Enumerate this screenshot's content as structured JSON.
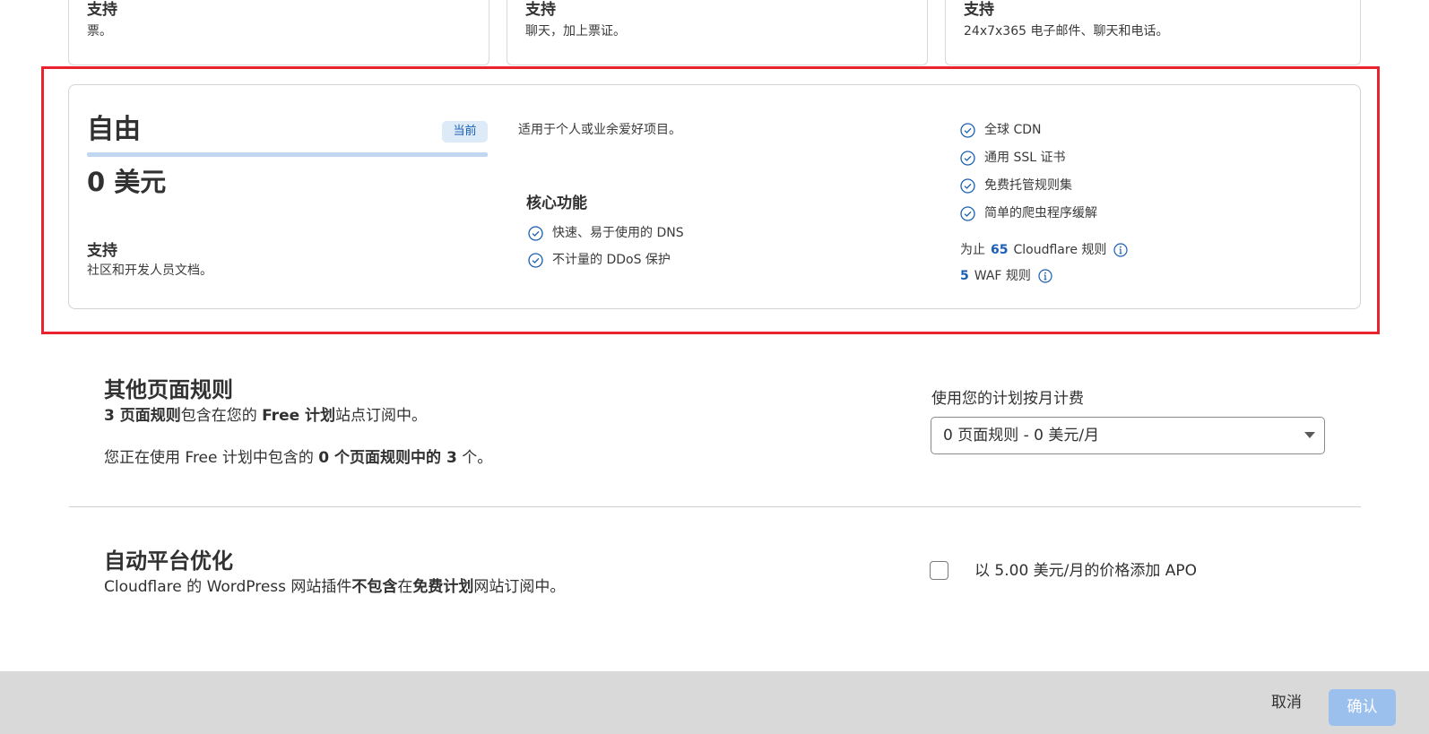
{
  "top_cards": [
    {
      "heading": "支持",
      "desc": "票。"
    },
    {
      "heading": "支持",
      "desc": "聊天，加上票证。"
    },
    {
      "heading": "支持",
      "desc": "24x7x365 电子邮件、聊天和电话。"
    }
  ],
  "plan": {
    "name": "自由",
    "badge": "当前",
    "price": "0 美元",
    "support_heading": "支持",
    "support_desc": "社区和开发人员文档。",
    "tagline": "适用于个人或业余爱好项目。",
    "core_heading": "核心功能",
    "core_features": [
      "快速、易于使用的 DNS",
      "不计量的 DDoS 保护"
    ],
    "features": [
      "全球 CDN",
      "通用 SSL 证书",
      "免费托管规则集",
      "简单的爬虫程序缓解"
    ],
    "limit_rules": {
      "prefix": "为止",
      "count": "65",
      "suffix": "Cloudflare 规则"
    },
    "limit_waf": {
      "count": "5",
      "suffix": "WAF 规则"
    }
  },
  "page_rules": {
    "title": "其他页面规则",
    "line1_bold1": "3 页面规则",
    "line1_text1": "包含在您的 ",
    "line1_bold2": "Free 计划",
    "line1_text2": "站点订阅中。",
    "line2_text1": "您正在使用 Free 计划中包含的 ",
    "line2_bold": "0 个页面规则中的 3",
    "line2_text2": " 个。",
    "field_label": "使用您的计划按月计费",
    "select_value": "0 页面规则 - 0 美元/月"
  },
  "apo": {
    "title": "自动平台优化",
    "text1": "Cloudflare 的 WordPress 网站插件",
    "bold1": "不包含",
    "text2": "在",
    "bold2": "免费计划",
    "text3": "网站订阅中。",
    "checkbox_label": "以 5.00 美元/月的价格添加 APO"
  },
  "footer": {
    "cancel_label": "取消",
    "confirm_label": "确认"
  },
  "colors": {
    "accent_blue": "#1a5fb4",
    "highlight_red": "#e8232f",
    "confirm_disabled": "#9cc0ee"
  }
}
